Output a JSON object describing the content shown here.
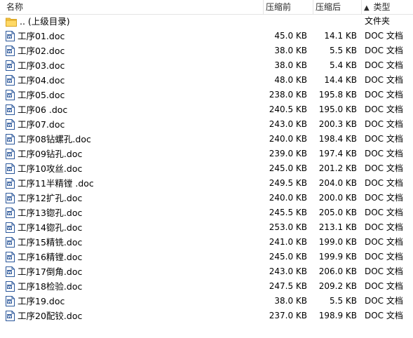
{
  "columns": {
    "name": "名称",
    "before": "压缩前",
    "after": "压缩后",
    "type": "类型",
    "sort_indicator": "▲"
  },
  "parent_row": {
    "name": ".. (上级目录)",
    "type": "文件夹",
    "icon": "folder-icon"
  },
  "files": [
    {
      "name": "工序01.doc",
      "before": "45.0 KB",
      "after": "14.1 KB",
      "type": "DOC 文档"
    },
    {
      "name": "工序02.doc",
      "before": "38.0 KB",
      "after": "5.5 KB",
      "type": "DOC 文档"
    },
    {
      "name": "工序03.doc",
      "before": "38.0 KB",
      "after": "5.4 KB",
      "type": "DOC 文档"
    },
    {
      "name": "工序04.doc",
      "before": "48.0 KB",
      "after": "14.4 KB",
      "type": "DOC 文档"
    },
    {
      "name": "工序05.doc",
      "before": "238.0 KB",
      "after": "195.8 KB",
      "type": "DOC 文档"
    },
    {
      "name": "工序06 .doc",
      "before": "240.5 KB",
      "after": "195.0 KB",
      "type": "DOC 文档"
    },
    {
      "name": "工序07.doc",
      "before": "243.0 KB",
      "after": "200.3 KB",
      "type": "DOC 文档"
    },
    {
      "name": "工序08钻螺孔.doc",
      "before": "240.0 KB",
      "after": "198.4 KB",
      "type": "DOC 文档"
    },
    {
      "name": "工序09钻孔.doc",
      "before": "239.0 KB",
      "after": "197.4 KB",
      "type": "DOC 文档"
    },
    {
      "name": "工序10攻丝.doc",
      "before": "245.0 KB",
      "after": "201.2 KB",
      "type": "DOC 文档"
    },
    {
      "name": "工序11半精镗 .doc",
      "before": "249.5 KB",
      "after": "204.0 KB",
      "type": "DOC 文档"
    },
    {
      "name": "工序12扩孔.doc",
      "before": "240.0 KB",
      "after": "200.0 KB",
      "type": "DOC 文档"
    },
    {
      "name": "工序13锪孔.doc",
      "before": "245.5 KB",
      "after": "205.0 KB",
      "type": "DOC 文档"
    },
    {
      "name": "工序14锪孔.doc",
      "before": "253.0 KB",
      "after": "213.1 KB",
      "type": "DOC 文档"
    },
    {
      "name": "工序15精铣.doc",
      "before": "241.0 KB",
      "after": "199.0 KB",
      "type": "DOC 文档"
    },
    {
      "name": "工序16精镗.doc",
      "before": "245.0 KB",
      "after": "199.9 KB",
      "type": "DOC 文档"
    },
    {
      "name": "工序17倒角.doc",
      "before": "243.0 KB",
      "after": "206.0 KB",
      "type": "DOC 文档"
    },
    {
      "name": "工序18检验.doc",
      "before": "247.5 KB",
      "after": "209.2 KB",
      "type": "DOC 文档"
    },
    {
      "name": "工序19.doc",
      "before": "38.0 KB",
      "after": "5.5 KB",
      "type": "DOC 文档"
    },
    {
      "name": "工序20配铰.doc",
      "before": "237.0 KB",
      "after": "198.9 KB",
      "type": "DOC 文档"
    }
  ],
  "colors": {
    "folder": "#f5c242",
    "doc_icon_blue": "#2b579a",
    "header_border": "#e5e5e5"
  }
}
